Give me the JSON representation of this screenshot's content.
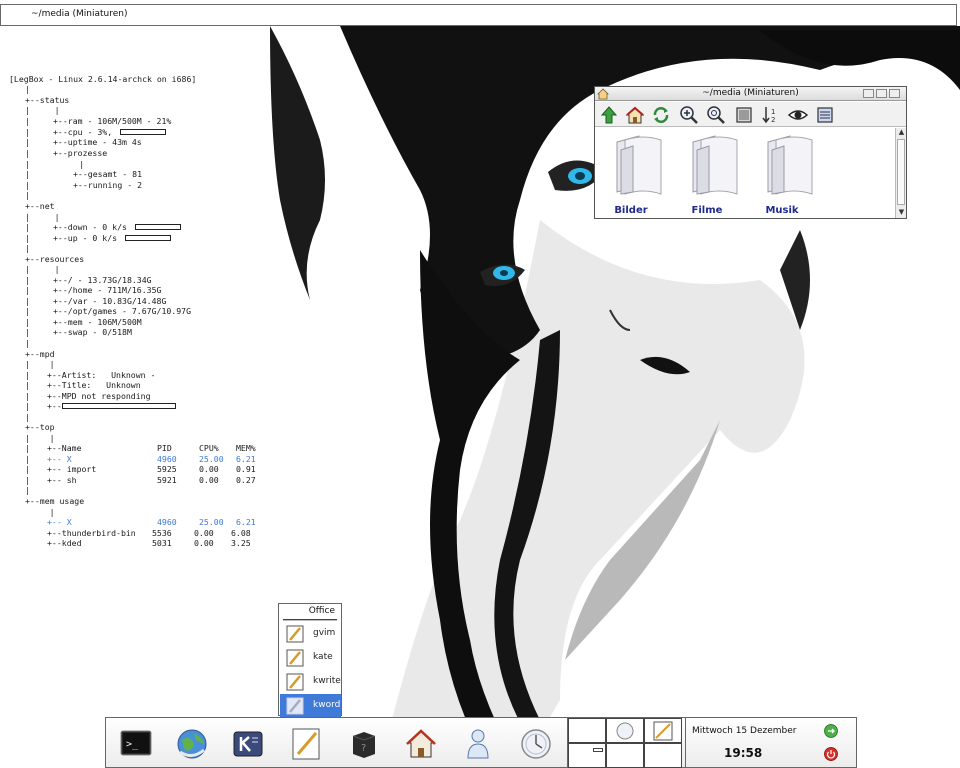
{
  "topbar": {
    "title": "~/media (Miniaturen)"
  },
  "conky": {
    "header": "[LegBox - Linux 2.6.14-archck on i686]",
    "status": {
      "label": "+--status",
      "ram": "+--ram - 106M/500M - 21%",
      "cpu": "+--cpu - 3%,",
      "cpu_percent": 3,
      "uptime": "+--uptime - 43m 4s",
      "prozesse": "+--prozesse",
      "gesamt": "+--gesamt - 81",
      "running": "+--running - 2"
    },
    "net": {
      "label": "+--net",
      "down": "+--down - 0 k/s",
      "up": "+--up - 0 k/s"
    },
    "resources": {
      "label": "+--resources",
      "items": [
        "+--/ - 13.73G/18.34G",
        "+--/home - 711M/16.35G",
        "+--/var - 10.83G/14.48G",
        "+--/opt/games - 7.67G/10.97G",
        "+--mem - 106M/500M",
        "+--swap - 0/518M"
      ]
    },
    "mpd": {
      "label": "+--mpd",
      "artist": "+--Artist:   Unknown -",
      "title": "+--Title:   Unknown",
      "status": "+--MPD not responding",
      "progress": "+--"
    },
    "top": {
      "label": "+--top",
      "headers": [
        "+--Name",
        "PID",
        "CPU%",
        "MEM%"
      ],
      "rows": [
        [
          "+-- X",
          "4960",
          "25.00",
          "6.21"
        ],
        [
          "+-- import",
          "5925",
          "0.00",
          "0.91"
        ],
        [
          "+-- sh",
          "5921",
          "0.00",
          "0.27"
        ]
      ]
    },
    "mem_usage": {
      "label": "+--mem usage",
      "rows": [
        [
          "+-- X",
          "4960",
          "25.00",
          "6.21"
        ],
        [
          "+--thunderbird-bin",
          "5536",
          "0.00",
          "6.08"
        ],
        [
          "+--kded",
          "5031",
          "0.00",
          "3.25"
        ]
      ]
    }
  },
  "file_manager": {
    "title": "~/media (Miniaturen)",
    "toolbar_icons": [
      "up-arrow-icon",
      "home-icon",
      "reload-icon",
      "zoom-in-icon",
      "zoom-out-icon",
      "view-mode-icon",
      "sort-icon",
      "preview-eye-icon",
      "details-view-icon"
    ],
    "folders": [
      "Bilder",
      "Filme",
      "Musik"
    ]
  },
  "office_menu": {
    "header": "Office",
    "items": [
      "gvim",
      "kate",
      "kwrite",
      "kword"
    ],
    "selected": "kword"
  },
  "taskbar": {
    "launchers": [
      "terminal-icon",
      "browser-globe-icon",
      "kmenu-icon",
      "office-notes-icon",
      "help-box-icon",
      "home-folder-icon",
      "user-icon",
      "clock-app-icon"
    ],
    "date": "Mittwoch 15 Dezember",
    "time": "19:58"
  },
  "colors": {
    "selection": "#3f7ad9",
    "highlight_text": "#3d7ad6",
    "folder_label": "#1f2a8c"
  }
}
